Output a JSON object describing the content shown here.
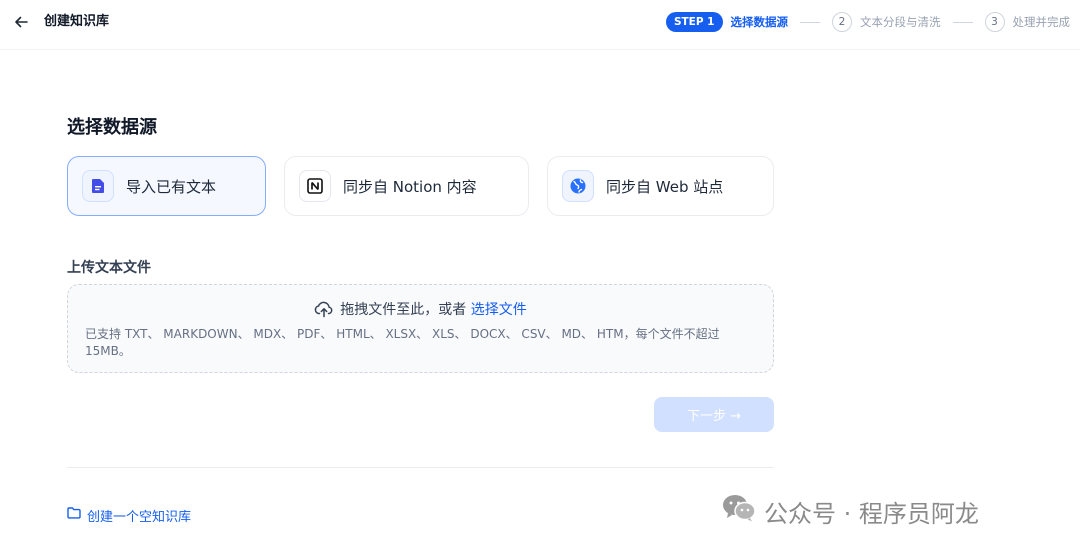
{
  "header": {
    "back_icon": "arrow-left-icon",
    "title": "创建知识库",
    "steps": [
      {
        "badge": "STEP 1",
        "label": "选择数据源",
        "active": true
      },
      {
        "number": "2",
        "label": "文本分段与清洗",
        "active": false
      },
      {
        "number": "3",
        "label": "处理并完成",
        "active": false
      }
    ]
  },
  "main": {
    "section_title": "选择数据源",
    "sources": [
      {
        "label": "导入已有文本",
        "icon": "document-icon",
        "selected": true
      },
      {
        "label": "同步自 Notion 内容",
        "icon": "notion-icon",
        "selected": false
      },
      {
        "label": "同步自 Web 站点",
        "icon": "globe-icon",
        "selected": false
      }
    ],
    "upload": {
      "title": "上传文本文件",
      "drop_text": "拖拽文件至此，或者 ",
      "choose_file": "选择文件",
      "hint": "已支持 TXT、 MARKDOWN、 MDX、 PDF、 HTML、 XLSX、 XLS、 DOCX、 CSV、 MD、 HTM，每个文件不超过 15MB。"
    },
    "next_button": "下一步 →",
    "create_empty": "创建一个空知识库"
  },
  "watermark": "公众号 · 程序员阿龙",
  "colors": {
    "accent": "#155eef",
    "selected_border": "#84adff",
    "selected_bg": "#f5f8ff",
    "disabled_button": "#d1e0ff"
  }
}
